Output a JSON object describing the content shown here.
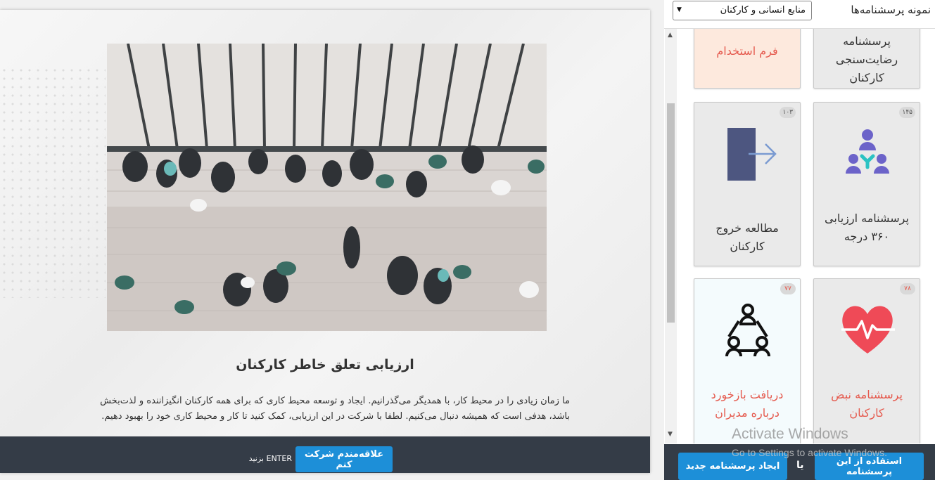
{
  "preview": {
    "title": "ارزیابی تعلق خاطر کارکنان",
    "description": "ما زمان زیادی را در محیط کار، با همدیگر می‌گذرانیم. ایجاد و توسعه محیط کاری که برای همه کارکنان انگیزاننده و لذت‌بخش باشد، هدفی است که همیشه دنبال می‌کنیم. لطفا با شرکت در این ارزیابی، کمک کنید تا کار و محیط کاری خود را بهبود دهیم.",
    "join_button": "علاقه‌مندم شرکت کنم",
    "enter_hint": "ENTER بزنید"
  },
  "samples": {
    "label": "نمونه پرسشنامه‌ها",
    "category": "منابع انسانی و کارکنان",
    "tiles": [
      {
        "label": "پرسشنامه رضایت‌سنجی کارکنان",
        "badge": "",
        "icon": "none"
      },
      {
        "label": "فرم استخدام",
        "badge": "",
        "icon": "none"
      },
      {
        "label": "پرسشنامه ارزیابی ۳۶۰ درجه",
        "badge": "۱۴۵",
        "icon": "team-360-icon"
      },
      {
        "label": "مطالعه خروج کارکنان",
        "badge": "۱۰۳",
        "icon": "exit-door-icon"
      },
      {
        "label": "پرسشنامه نبض کارکنان",
        "badge": "۷۸",
        "icon": "heart-pulse-icon"
      },
      {
        "label": "دریافت بازخورد درباره مدیران",
        "badge": "۷۷",
        "icon": "org-chart-icon"
      }
    ],
    "use_button": "استفاده از این پرسشنامه",
    "or_text": "یا",
    "new_button": "ایجاد پرسشنامه جدید"
  },
  "watermark": {
    "line1": "Activate Windows",
    "line2": "Go to Settings to activate Windows."
  },
  "colors": {
    "primary_button": "#1d8fd8",
    "dark_bar": "#343c47",
    "accent_red": "#e55a4e",
    "heart_red": "#ef4a57",
    "team_purple": "#6c63c9",
    "team_teal": "#2bc3c3",
    "door_navy": "#4d5680"
  }
}
